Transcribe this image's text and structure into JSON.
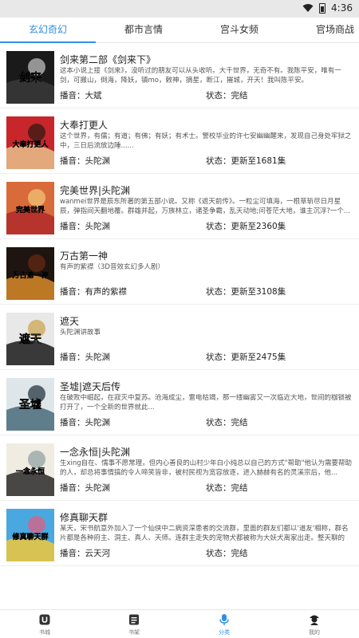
{
  "status_bar": {
    "time": "4:36"
  },
  "tabs": [
    {
      "label": "玄幻奇幻",
      "active": true
    },
    {
      "label": "都市言情",
      "active": false
    },
    {
      "label": "宫斗女频",
      "active": false
    },
    {
      "label": "官场商战",
      "active": false
    }
  ],
  "books": [
    {
      "title": "剑来第二部《剑来下》",
      "desc": "这本小说上接《剑来》，没听过的朋友可以从头收听。大千世界，无奇不有。我陈平安，唯有一剑，可搬山，倒海，降妖，镇mo，敕神，摘星，断江，摧城，开天！我叫陈平安。",
      "narrator": "播音：大斌",
      "status": "状态：完结",
      "cover_text": "剑来",
      "cover_colors": [
        "#1a1a1a",
        "#3a3a3a",
        "#c9c9c9"
      ]
    },
    {
      "title": "大奉打更人",
      "desc": "这个世界，有儒；有道；有佛；有妖；有术士。警校毕业的许七安幽幽醒来，发现自己身处牢狱之中，三日后流放边陲......",
      "narrator": "播音：头陀渊",
      "status": "状态：更新至1681集",
      "cover_text": "大奉打更人",
      "cover_colors": [
        "#c8262a",
        "#e8c08a",
        "#2a1a12"
      ]
    },
    {
      "title": "完美世界|头陀渊",
      "desc": "wanmei世界是辰东所著的第五部小说。又称《遮天前传》。一粒尘可填海，一根草斩尽日月星辰，弹指间天翻地覆。群雄并起，万族林立，诸圣争霸，乱天动地;问苍茫大地，谁主沉浮?一个...",
      "narrator": "播音：头陀渊",
      "status": "状态：更新至2360集",
      "cover_text": "完美世界",
      "cover_colors": [
        "#d96b3a",
        "#b02a2a",
        "#f2c77a"
      ]
    },
    {
      "title": "万古第一神",
      "desc": "有声的紫襟（3D音效玄幻多人剧）",
      "narrator": "播音：有声的紫襟",
      "status": "状态：更新至3108集",
      "cover_text": "万古第一神",
      "cover_colors": [
        "#1e1410",
        "#d98a2a",
        "#6a2a12"
      ]
    },
    {
      "title": "遮天",
      "desc": "头陀渊讲故事",
      "narrator": "播音：头陀渊",
      "status": "状态：更新至2475集",
      "cover_text": "遮天",
      "cover_colors": [
        "#e8e8e8",
        "#1a1a1a",
        "#c9a24a"
      ]
    },
    {
      "title": "圣墟|遮天后传",
      "desc": "在破败中崛起，在寂灭中复苏。沧海成尘，雷电枯竭，那一缕幽雾又一次临近大地，世间的枷锁被打开了，一个全新的世界就此...",
      "narrator": "播音：头陀渊",
      "status": "状态：完结",
      "cover_text": "圣墟",
      "cover_colors": [
        "#dfe6ea",
        "#4a6a7a",
        "#1a2a34"
      ]
    },
    {
      "title": "一念永恒|头陀渊",
      "desc": "生xing自在、懦事不愿常理，但内心善良的山村少年白小纯总以自己的方式\"帮助\"他认为需要帮助的人，却总将事情搞的令人啼笑皆非，被村民视为宽容放逐，进入赫赫有名的灵溪宗后，他...",
      "narrator": "播音：头陀渊",
      "status": "状态：完结",
      "cover_text": "一念永恒",
      "cover_colors": [
        "#f0ece2",
        "#2a2a2a",
        "#8aa0a0"
      ]
    },
    {
      "title": "修真聊天群",
      "desc": "某天，宋书航意外加入了一个仙侠中二病资深患者的交流群，里面的群友们都以'道友'相称，群名片都是各种府主、洞主、真人、天师。连群主走失的宠物犬都被称为大妖犬离家出走。整天聊的是...",
      "narrator": "播音：云天河",
      "status": "状态：完结",
      "cover_text": "修真聊天群",
      "cover_colors": [
        "#4aa8e0",
        "#f0c83a",
        "#e85a7a"
      ]
    }
  ],
  "bottom_nav": [
    {
      "label": "书城",
      "icon": "bookstore-icon",
      "active": false
    },
    {
      "label": "书架",
      "icon": "bookshelf-icon",
      "active": false
    },
    {
      "label": "分类",
      "icon": "microphone-icon",
      "active": true
    },
    {
      "label": "我的",
      "icon": "profile-icon",
      "active": false
    }
  ],
  "colors": {
    "accent": "#2f8fe6",
    "text": "#222222",
    "muted": "#555555"
  }
}
